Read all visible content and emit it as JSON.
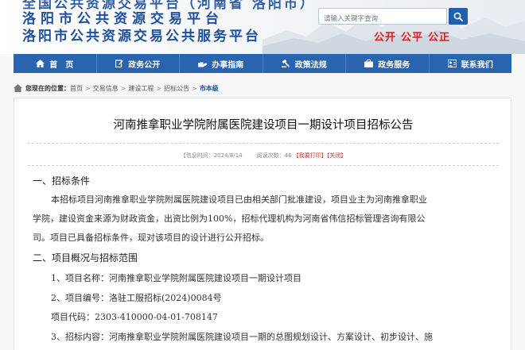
{
  "header": {
    "top_line_partial": "全国公共资源交易平台（河南省 洛阳市）",
    "line1": "洛阳市公共资源交易平台",
    "line2": "洛阳市公共资源交易公共服务平台",
    "search_placeholder": "请输入关键字查询",
    "slogan": [
      "公开",
      "公平",
      "公正"
    ]
  },
  "nav": {
    "items": [
      {
        "label": "首　页",
        "icon": "home-icon"
      },
      {
        "label": "政务公开",
        "icon": "document-edit-icon"
      },
      {
        "label": "办事指南",
        "icon": "hand-icon"
      },
      {
        "label": "政策法规",
        "icon": "gavel-icon"
      },
      {
        "label": "政务服务",
        "icon": "briefcase-icon"
      },
      {
        "label": "联系我们",
        "icon": "contact-icon"
      }
    ]
  },
  "breadcrumb": {
    "lead": "您现在的位置：",
    "items": [
      "首页",
      "交易信息",
      "建设工程",
      "招标公告"
    ],
    "current": "市本级"
  },
  "article": {
    "title": "河南推拿职业学院附属医院建设项目一期设计项目招标公告",
    "meta_source": "【信息时间：",
    "meta_date": "2024/8/14",
    "meta_views_label": "阅读次数：",
    "meta_views": "46",
    "meta_fav": "【我要打印】",
    "meta_close": "【关闭】",
    "lines": [
      "一、招标条件",
      "本招标项目河南推拿职业学院附属医院建设项目已由相关部门批准建设，项目业主为河南推拿职业",
      "学院，建设资金来源为财政资金，出资比例为100%，招标代理机构为河南省伟信招标管理咨询有限公",
      "司。项目已具备招标条件，现对该项目的设计进行公开招标。",
      "二、项目概况与招标范围",
      "1、项目名称：河南推拿职业学院附属医院建设项目一期设计项目",
      "2、项目编号：洛驻工服招标(2024)0084号",
      "项目代码：2303-410000-04-01-708147",
      "3、招标内容：河南推拿职业学院附属医院建设项目一期的总图规划设计、方案设计、初步设计、施"
    ]
  },
  "colors": {
    "brand_blue": "#1d4f9a",
    "nav_blue": "#2a64ae",
    "slogan_red": "#d81e1e"
  }
}
